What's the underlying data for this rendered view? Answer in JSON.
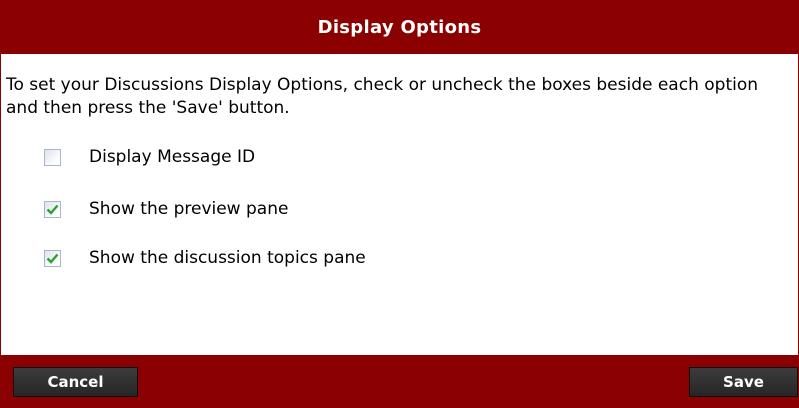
{
  "dialog": {
    "title": "Display Options",
    "instructions": "To set your Discussions Display Options, check or uncheck the boxes beside each option and then press the 'Save' button."
  },
  "options": [
    {
      "label": "Display Message ID",
      "checked": false
    },
    {
      "label": "Show the preview pane",
      "checked": true
    },
    {
      "label": "Show the discussion topics pane",
      "checked": true
    }
  ],
  "footer": {
    "cancel_label": "Cancel",
    "save_label": "Save"
  },
  "colors": {
    "header_bg": "#8b0000",
    "button_bg": "#2e2e2e",
    "checkmark": "#2ea02e"
  }
}
